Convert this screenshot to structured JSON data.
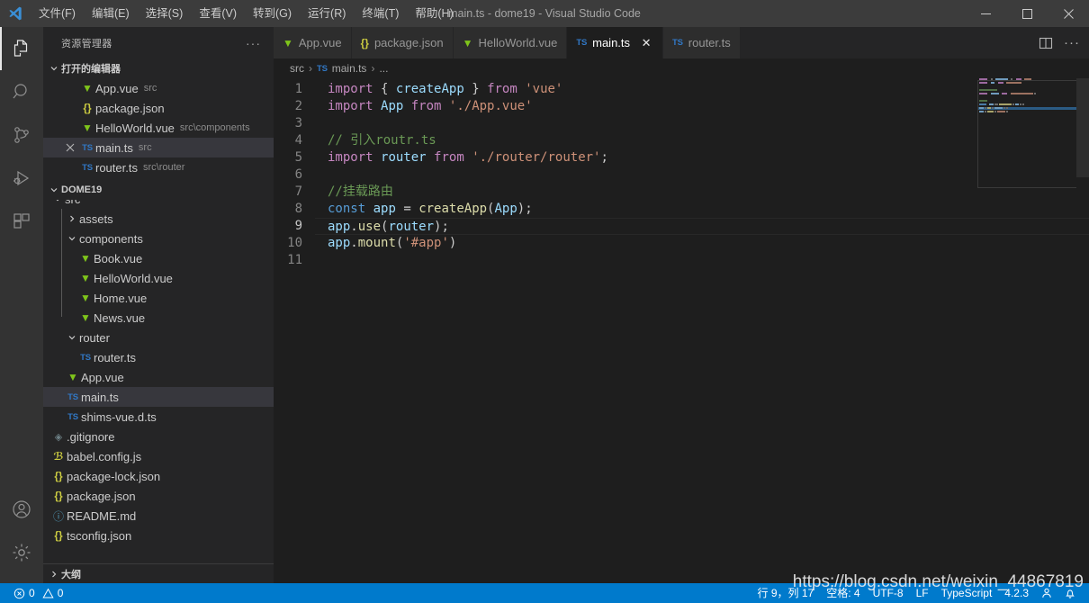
{
  "window": {
    "title": "main.ts - dome19 - Visual Studio Code",
    "minimize_label": "—",
    "maximize_label": "☐",
    "close_label": "✕"
  },
  "menu": {
    "items": [
      {
        "label": "文件(F)"
      },
      {
        "label": "编辑(E)"
      },
      {
        "label": "选择(S)"
      },
      {
        "label": "查看(V)"
      },
      {
        "label": "转到(G)"
      },
      {
        "label": "运行(R)"
      },
      {
        "label": "终端(T)"
      },
      {
        "label": "帮助(H)"
      }
    ]
  },
  "activity_bar": {
    "items": [
      {
        "name": "explorer",
        "active": true
      },
      {
        "name": "search",
        "active": false
      },
      {
        "name": "source-control",
        "active": false
      },
      {
        "name": "run-and-debug",
        "active": false
      },
      {
        "name": "extensions",
        "active": false
      }
    ],
    "bottom": [
      {
        "name": "accounts"
      },
      {
        "name": "settings"
      }
    ]
  },
  "sidebar": {
    "header": "资源管理器",
    "more_actions": "···",
    "open_editors": {
      "title": "打开的编辑器",
      "items": [
        {
          "name": "App.vue",
          "desc": "src",
          "icon": "vue",
          "selected": false,
          "dirty": false
        },
        {
          "name": "package.json",
          "desc": "",
          "icon": "json",
          "selected": false,
          "dirty": false
        },
        {
          "name": "HelloWorld.vue",
          "desc": "src\\components",
          "icon": "vue",
          "selected": false,
          "dirty": false
        },
        {
          "name": "main.ts",
          "desc": "src",
          "icon": "ts",
          "selected": true,
          "dirty": false
        },
        {
          "name": "router.ts",
          "desc": "src\\router",
          "icon": "ts",
          "selected": false,
          "dirty": false
        }
      ]
    },
    "project": {
      "title": "DOME19",
      "items": [
        {
          "name": "src",
          "icon": "folder-open",
          "indent": 1,
          "expanded": true,
          "clipped": true
        },
        {
          "name": "assets",
          "icon": "folder",
          "indent": 2,
          "expanded": false
        },
        {
          "name": "components",
          "icon": "folder-open",
          "indent": 2,
          "expanded": true
        },
        {
          "name": "Book.vue",
          "icon": "vue",
          "indent": 3
        },
        {
          "name": "HelloWorld.vue",
          "icon": "vue",
          "indent": 3
        },
        {
          "name": "Home.vue",
          "icon": "vue",
          "indent": 3
        },
        {
          "name": "News.vue",
          "icon": "vue",
          "indent": 3
        },
        {
          "name": "router",
          "icon": "folder-open",
          "indent": 2,
          "expanded": true
        },
        {
          "name": "router.ts",
          "icon": "ts",
          "indent": 3
        },
        {
          "name": "App.vue",
          "icon": "vue",
          "indent": 2
        },
        {
          "name": "main.ts",
          "icon": "ts",
          "indent": 2,
          "selected": true
        },
        {
          "name": "shims-vue.d.ts",
          "icon": "ts",
          "indent": 2
        },
        {
          "name": ".gitignore",
          "icon": "git",
          "indent": 1
        },
        {
          "name": "babel.config.js",
          "icon": "js",
          "indent": 1
        },
        {
          "name": "package-lock.json",
          "icon": "json",
          "indent": 1
        },
        {
          "name": "package.json",
          "icon": "json",
          "indent": 1
        },
        {
          "name": "README.md",
          "icon": "md",
          "indent": 1
        },
        {
          "name": "tsconfig.json",
          "icon": "json",
          "indent": 1
        }
      ]
    },
    "outline": {
      "title": "大纲"
    }
  },
  "tabs": {
    "items": [
      {
        "label": "App.vue",
        "icon": "vue",
        "active": false,
        "closable": false
      },
      {
        "label": "package.json",
        "icon": "json",
        "active": false,
        "closable": false
      },
      {
        "label": "HelloWorld.vue",
        "icon": "vue",
        "active": false,
        "closable": false
      },
      {
        "label": "main.ts",
        "icon": "ts",
        "active": true,
        "closable": true
      },
      {
        "label": "router.ts",
        "icon": "ts",
        "active": false,
        "closable": false
      }
    ],
    "close_label": "✕",
    "actions": [
      {
        "name": "split-editor"
      },
      {
        "name": "more-actions",
        "label": "···"
      }
    ]
  },
  "breadcrumb": {
    "parts": [
      "src",
      "main.ts",
      "..."
    ],
    "separator": "›"
  },
  "editor": {
    "language": "typescript",
    "current_line": 9,
    "line_numbers": [
      1,
      2,
      3,
      4,
      5,
      6,
      7,
      8,
      9,
      10,
      11
    ],
    "lines": [
      {
        "n": 1,
        "tokens": [
          {
            "t": "import",
            "c": "k-kw"
          },
          {
            "t": " ",
            "c": "k-punc"
          },
          {
            "t": "{",
            "c": "k-punc"
          },
          {
            "t": " ",
            "c": "k-punc"
          },
          {
            "t": "createApp",
            "c": "k-var"
          },
          {
            "t": " ",
            "c": "k-punc"
          },
          {
            "t": "}",
            "c": "k-punc"
          },
          {
            "t": " ",
            "c": "k-punc"
          },
          {
            "t": "from",
            "c": "k-kw"
          },
          {
            "t": " ",
            "c": "k-punc"
          },
          {
            "t": "'vue'",
            "c": "k-str"
          }
        ]
      },
      {
        "n": 2,
        "tokens": [
          {
            "t": "import",
            "c": "k-kw"
          },
          {
            "t": " ",
            "c": "k-punc"
          },
          {
            "t": "App",
            "c": "k-var"
          },
          {
            "t": " ",
            "c": "k-punc"
          },
          {
            "t": "from",
            "c": "k-kw"
          },
          {
            "t": " ",
            "c": "k-punc"
          },
          {
            "t": "'./App.vue'",
            "c": "k-str"
          }
        ]
      },
      {
        "n": 3,
        "tokens": []
      },
      {
        "n": 4,
        "tokens": [
          {
            "t": "// 引入routr.ts",
            "c": "k-cmt"
          }
        ]
      },
      {
        "n": 5,
        "tokens": [
          {
            "t": "import",
            "c": "k-kw"
          },
          {
            "t": " ",
            "c": "k-punc"
          },
          {
            "t": "router",
            "c": "k-var"
          },
          {
            "t": " ",
            "c": "k-punc"
          },
          {
            "t": "from",
            "c": "k-kw"
          },
          {
            "t": " ",
            "c": "k-punc"
          },
          {
            "t": "'./router/router'",
            "c": "k-str"
          },
          {
            "t": ";",
            "c": "k-punc"
          }
        ]
      },
      {
        "n": 6,
        "tokens": []
      },
      {
        "n": 7,
        "tokens": [
          {
            "t": "//挂载路由",
            "c": "k-cmt"
          }
        ]
      },
      {
        "n": 8,
        "tokens": [
          {
            "t": "const",
            "c": "k-kw2"
          },
          {
            "t": " ",
            "c": "k-punc"
          },
          {
            "t": "app",
            "c": "k-var"
          },
          {
            "t": " = ",
            "c": "k-punc"
          },
          {
            "t": "createApp",
            "c": "k-fn"
          },
          {
            "t": "(",
            "c": "k-punc"
          },
          {
            "t": "App",
            "c": "k-var"
          },
          {
            "t": ")",
            "c": "k-punc"
          },
          {
            "t": ";",
            "c": "k-punc"
          }
        ]
      },
      {
        "n": 9,
        "tokens": [
          {
            "t": "app",
            "c": "k-var"
          },
          {
            "t": ".",
            "c": "k-punc"
          },
          {
            "t": "use",
            "c": "k-fn"
          },
          {
            "t": "(",
            "c": "k-punc"
          },
          {
            "t": "router",
            "c": "k-var"
          },
          {
            "t": ")",
            "c": "k-punc"
          },
          {
            "t": ";",
            "c": "k-punc"
          }
        ]
      },
      {
        "n": 10,
        "tokens": [
          {
            "t": "app",
            "c": "k-var"
          },
          {
            "t": ".",
            "c": "k-punc"
          },
          {
            "t": "mount",
            "c": "k-fn"
          },
          {
            "t": "(",
            "c": "k-punc"
          },
          {
            "t": "'#app'",
            "c": "k-str"
          },
          {
            "t": ")",
            "c": "k-punc"
          }
        ]
      },
      {
        "n": 11,
        "tokens": []
      }
    ]
  },
  "statusbar": {
    "errors": "0",
    "warnings": "0",
    "position": "行 9，列 17",
    "indent": "空格: 4",
    "encoding": "UTF-8",
    "eol": "LF",
    "language": "TypeScript",
    "version": "4.2.3",
    "feedback_icon": "smiley-icon",
    "bell_icon": "bell-icon"
  },
  "watermark": "https://blog.csdn.net/weixin_44867819",
  "colors": {
    "accent": "#007acc",
    "titlebar_bg": "#3c3c3c",
    "sidebar_bg": "#252526",
    "editor_bg": "#1e1e1e",
    "activitybar_bg": "#333333",
    "selection_bg": "#37373d",
    "vue_green": "#7fc41b",
    "ts_blue": "#3178c6",
    "json_yellow": "#cbcb41"
  }
}
